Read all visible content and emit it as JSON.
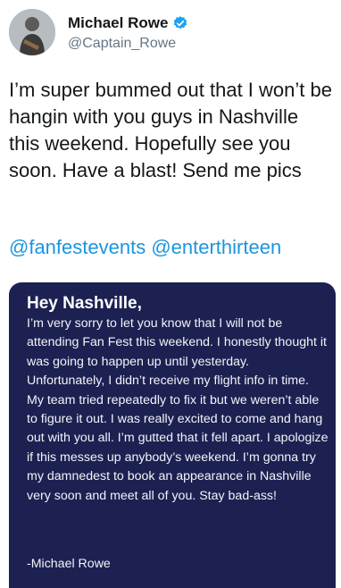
{
  "user": {
    "name": "Michael Rowe",
    "handle": "@Captain_Rowe",
    "verified": true
  },
  "tweet": {
    "text": "I’m super bummed out that I won’t be hangin with you guys in Nashville this weekend. Hopefully see you soon. Have a blast! Send me pics",
    "mentions": [
      "@fanfestevents",
      "@enterthirteen"
    ]
  },
  "media_note": {
    "title": "Hey Nashville,",
    "body": "I’m very sorry to let you know that I will not be attending Fan Fest this weekend. I honestly thought it was going to happen up until yesterday. Unfortunately, I didn’t receive my flight info in time. My team tried repeatedly to fix it but we weren’t able to figure it out. I was really excited to come and hang out with you all. I’m gutted that it fell apart. I apologize if this messes up anybody’s weekend. I’m gonna try my damnedest to book an appearance in Nashville very soon and meet all of you. Stay bad-ass!",
    "signature": "-Michael Rowe"
  },
  "colors": {
    "link": "#1b95e0",
    "note_background": "#1c2152",
    "verified_badge": "#1da1f2"
  }
}
